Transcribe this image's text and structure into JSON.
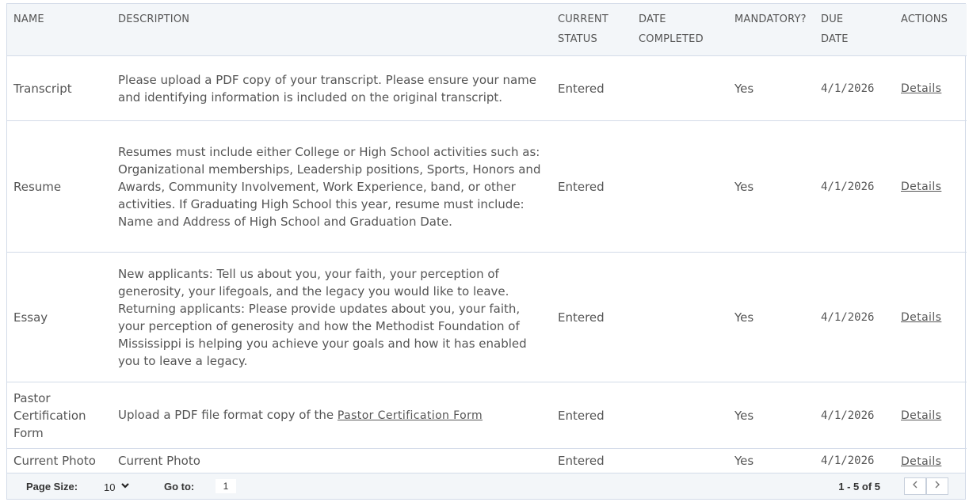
{
  "columns": {
    "name": "NAME",
    "description": "DESCRIPTION",
    "current_status_l1": "CURRENT",
    "current_status_l2": "STATUS",
    "date_completed_l1": "DATE",
    "date_completed_l2": "COMPLETED",
    "mandatory": "MANDATORY?",
    "due_date_l1": "DUE",
    "due_date_l2": "DATE",
    "actions": "ACTIONS"
  },
  "rows": [
    {
      "name": "Transcript",
      "description": "Please upload a PDF copy of your transcript. Please ensure your name and identifying information is included on the original transcript.",
      "status": "Entered",
      "date_completed": "",
      "mandatory": "Yes",
      "due_date": "4/1/2026",
      "action": "Details"
    },
    {
      "name": "Resume",
      "description": "Resumes must include either College or High School activities such as: Organizational memberships, Leadership positions, Sports, Honors and Awards, Community Involvement, Work Experience, band, or other activities. If Graduating High School this year, resume must include: Name and Address of High School and Graduation Date.",
      "status": "Entered",
      "date_completed": "",
      "mandatory": "Yes",
      "due_date": "4/1/2026",
      "action": "Details"
    },
    {
      "name": "Essay",
      "description": "New applicants: Tell us about you, your faith, your perception of generosity, your lifegoals, and the legacy you would like to leave. Returning applicants: Please provide updates about you, your faith, your perception of generosity and how the Methodist Foundation of Mississippi is helping you achieve your goals and how it has enabled you to leave a legacy.",
      "status": "Entered",
      "date_completed": "",
      "mandatory": "Yes",
      "due_date": "4/1/2026",
      "action": "Details"
    },
    {
      "name": "Pastor Certification Form",
      "description_prefix": "Upload a PDF file format copy of the",
      "description_link": "Pastor Certification Form",
      "status": "Entered",
      "date_completed": "",
      "mandatory": "Yes",
      "due_date": "4/1/2026",
      "action": "Details"
    },
    {
      "name": "Current Photo",
      "description": "Current Photo",
      "status": "Entered",
      "date_completed": "",
      "mandatory": "Yes",
      "due_date": "4/1/2026",
      "action": "Details"
    }
  ],
  "footer": {
    "page_size_label": "Page Size:",
    "page_size_value": "10",
    "goto_label": "Go to:",
    "goto_value": "1",
    "count_text": "1 - 5 of 5"
  },
  "icons": {
    "dropdown": "chevron-down-icon",
    "prev": "chevron-left-icon",
    "next": "chevron-right-icon"
  },
  "colors": {
    "header_bg": "#f3f6f9",
    "border": "#d3dbe8",
    "text": "#555555"
  }
}
